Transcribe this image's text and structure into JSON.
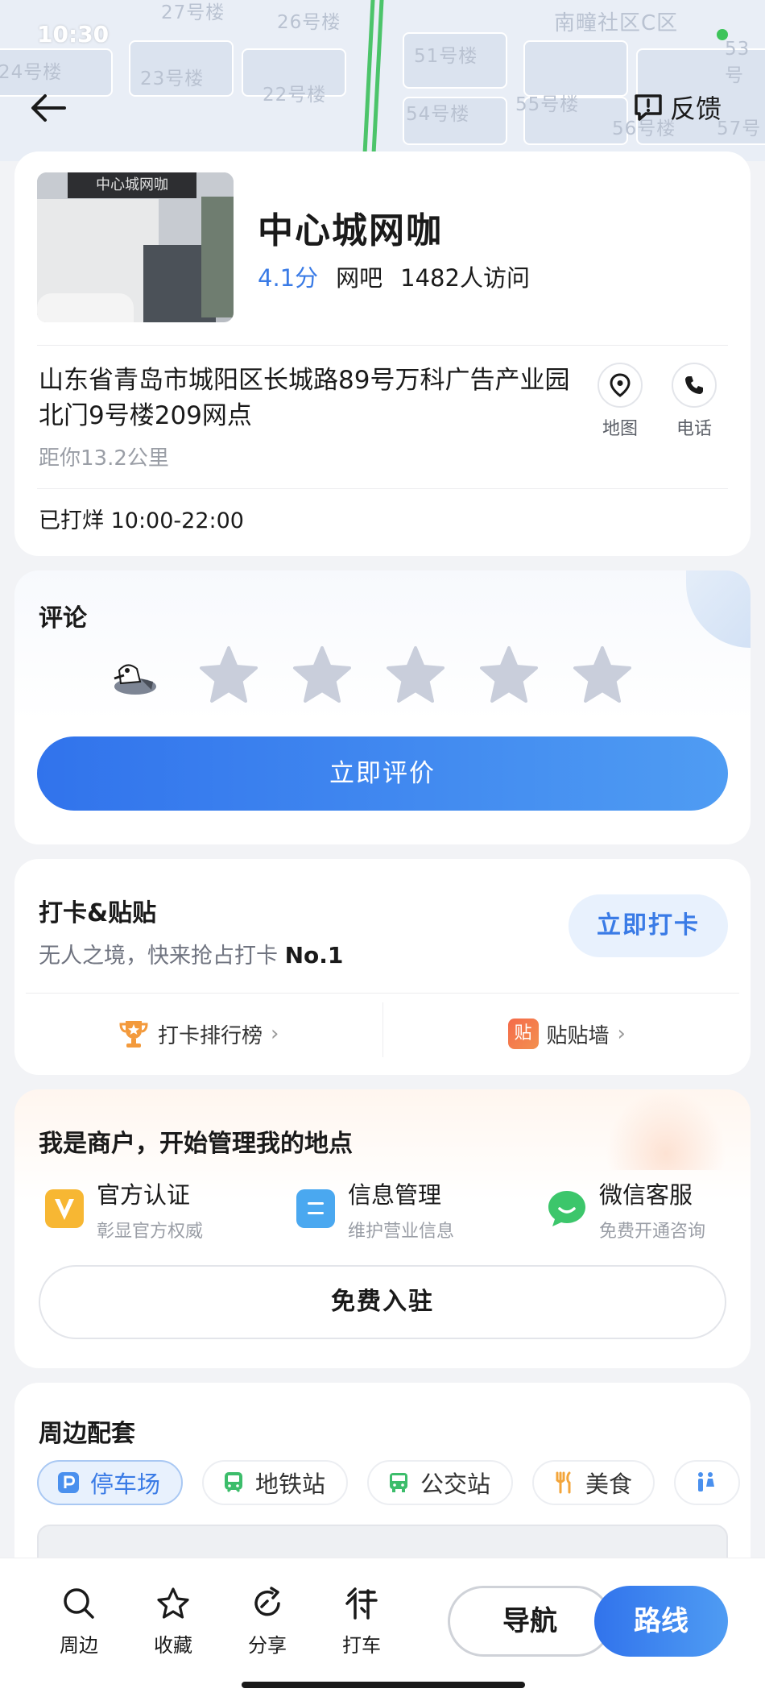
{
  "status_bar": {
    "time": "10:30"
  },
  "map": {
    "labels": [
      "27号楼",
      "26号楼",
      "南疃社区C区",
      "24号楼",
      "23号楼",
      "22号楼",
      "51号楼",
      "53号",
      "54号楼",
      "55号楼",
      "56号楼",
      "57号"
    ]
  },
  "header": {
    "feedback_label": "反馈"
  },
  "place": {
    "name": "中心城网咖",
    "score": "4.1分",
    "category": "网吧",
    "visits": "1482人访问",
    "address": "山东省青岛市城阳区长城路89号万科广告产业园北门9号楼209网点",
    "distance": "距你13.2公里",
    "hours": "已打烊 10:00-22:00",
    "photo_sign": "中心城网咖"
  },
  "actions": {
    "map_label": "地图",
    "phone_label": "电话"
  },
  "review": {
    "title": "评论",
    "button_label": "立即评价",
    "star_count": 5
  },
  "checkin": {
    "title": "打卡&贴贴",
    "subtitle": "无人之境，快来抢占打卡",
    "subtitle_strong": "No.1",
    "button_label": "立即打卡",
    "ranking_label": "打卡排行榜",
    "wall_label": "贴贴墙",
    "wall_icon_char": "贴",
    "chevron": "›"
  },
  "merchant": {
    "title": "我是商户，开始管理我的地点",
    "features": [
      {
        "title": "官方认证",
        "sub": "彰显官方权威",
        "color": "#f7b733"
      },
      {
        "title": "信息管理",
        "sub": "维护营业信息",
        "color": "#4aa8f0"
      },
      {
        "title": "微信客服",
        "sub": "免费开通咨询",
        "color": "#3cc66b"
      }
    ],
    "join_label": "免费入驻"
  },
  "nearby": {
    "title": "周边配套",
    "chips": [
      {
        "label": "停车场",
        "icon": "parking-icon",
        "active": true
      },
      {
        "label": "地铁站",
        "icon": "subway-icon",
        "active": false
      },
      {
        "label": "公交站",
        "icon": "bus-icon",
        "active": false
      },
      {
        "label": "美食",
        "icon": "food-icon",
        "active": false
      }
    ]
  },
  "bottom_bar": {
    "tabs": [
      {
        "label": "周边",
        "icon": "search-icon"
      },
      {
        "label": "收藏",
        "icon": "star-icon"
      },
      {
        "label": "分享",
        "icon": "share-icon"
      },
      {
        "label": "打车",
        "icon": "taxi-icon"
      }
    ],
    "nav_label": "导航",
    "route_label": "路线"
  },
  "colors": {
    "accent": "#3a7be6",
    "star_inactive": "#c9cedb",
    "background": "#f2f3f6"
  }
}
